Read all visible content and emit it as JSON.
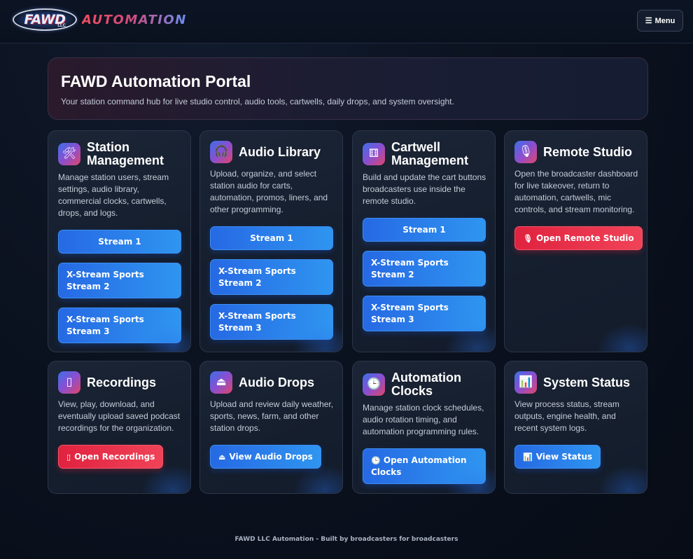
{
  "header": {
    "logo_text": "FAWD",
    "logo_llc": "LLC",
    "brand_word": "AUTOMATION",
    "menu_label": "Menu",
    "menu_icon": "hamburger-icon"
  },
  "hero": {
    "title": "FAWD Automation Portal",
    "subtitle": "Your station command hub for live studio control, audio tools, cartwells, daily drops, and system oversight."
  },
  "cards": {
    "station": {
      "icon": "tools-icon",
      "title_line1": "Station",
      "title_line2": "Management",
      "desc": "Manage station users, stream settings, audio library, commercial clocks, cartwells, drops, and logs.",
      "buttons": [
        "Stream 1",
        "X-Stream Sports Stream 2",
        "X-Stream Sports Stream 3"
      ]
    },
    "audio_library": {
      "icon": "headphones-icon",
      "title": "Audio Library",
      "desc": "Upload, organize, and select station audio for carts, automation, promos, liners, and other programming.",
      "buttons": [
        "Stream 1",
        "X-Stream Sports Stream 2",
        "X-Stream Sports Stream 3"
      ]
    },
    "cartwell": {
      "icon": "dice-icon",
      "title_line1": "Cartwell",
      "title_line2": "Management",
      "desc": "Build and update the cart buttons broadcasters use inside the remote studio.",
      "buttons": [
        "Stream 1",
        "X-Stream Sports Stream 2",
        "X-Stream Sports Stream 3"
      ]
    },
    "remote_studio": {
      "icon": "microphone-icon",
      "title": "Remote Studio",
      "desc": "Open the broadcaster dashboard for live takeover, return to automation, cartwells, mic controls, and stream monitoring.",
      "button": "Open Remote Studio"
    },
    "recordings": {
      "icon": "recorder-icon",
      "title": "Recordings",
      "desc": "View, play, download, and eventually upload saved podcast recordings for the organization.",
      "button": "Open Recordings"
    },
    "audio_drops": {
      "icon": "drop-icon",
      "title": "Audio Drops",
      "desc": "Upload and review daily weather, sports, news, farm, and other station drops.",
      "button": "View Audio Drops"
    },
    "automation_clocks": {
      "icon": "clock-icon",
      "title_line1": "Automation",
      "title_line2": "Clocks",
      "desc": "Manage station clock schedules, audio rotation timing, and automation programming rules.",
      "button": "Open Automation Clocks"
    },
    "system_status": {
      "icon": "chart-icon",
      "title": "System Status",
      "desc": "View process status, stream outputs, engine health, and recent system logs.",
      "button": "View Status"
    }
  },
  "footer": {
    "text": "FAWD LLC Automation - Built by broadcasters for broadcasters"
  }
}
